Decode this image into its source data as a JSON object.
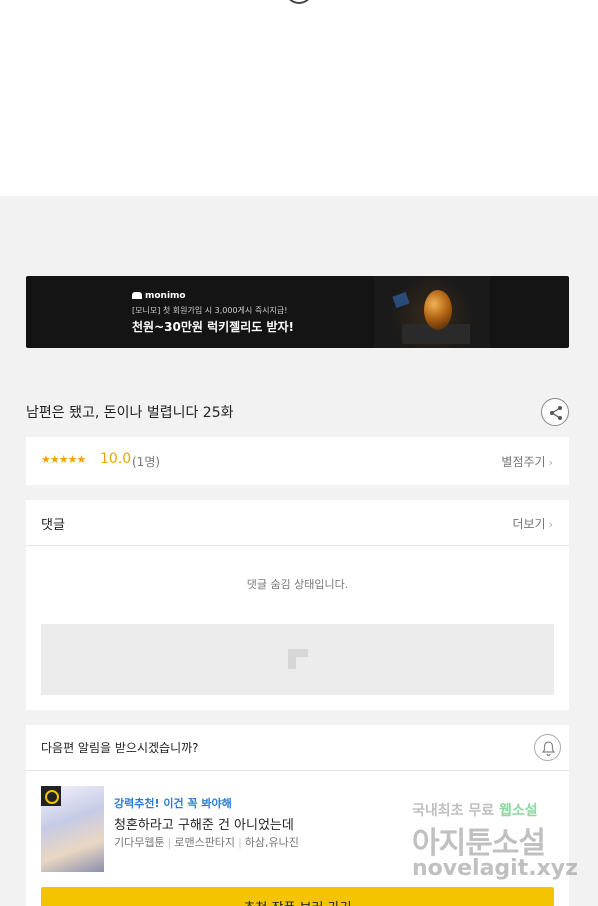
{
  "banner": {
    "brand": "monimo",
    "sub": "[모니모] 첫 회원가입 시 3,000게시 즉시지급!",
    "headline": "천원~30만원 럭키젤리도 받자!"
  },
  "episode": {
    "title": "남편은 됐고, 돈이나 벌렵니다 25화"
  },
  "rating": {
    "stars": "★★★★★",
    "score": "10.0",
    "count": "(1명)",
    "action_label": "별점주기"
  },
  "comments": {
    "label": "댓글",
    "more_label": "더보기",
    "hidden_text": "댓글 숨김 상태입니다."
  },
  "alarm": {
    "question": "다음편 알림을 받으시겠습니까?"
  },
  "recommendation": {
    "tag": "강력추천! 이건 꼭 봐야해",
    "title": "청혼하라고 구해준 건 아니었는데",
    "meta": [
      "기다무웹툰",
      "로맨스판타지",
      "하삼,유나진"
    ],
    "button_label": "추천 작품 보러 가기"
  },
  "watermark": {
    "line1_a": "국내최초 무료 ",
    "line1_b": "웹소설",
    "line2": "아지툰소설",
    "line3": "novelagit.xyz"
  },
  "colors": {
    "accent_yellow": "#f5c400",
    "star_orange": "#f5a200",
    "tag_blue": "#2b7cd3"
  }
}
